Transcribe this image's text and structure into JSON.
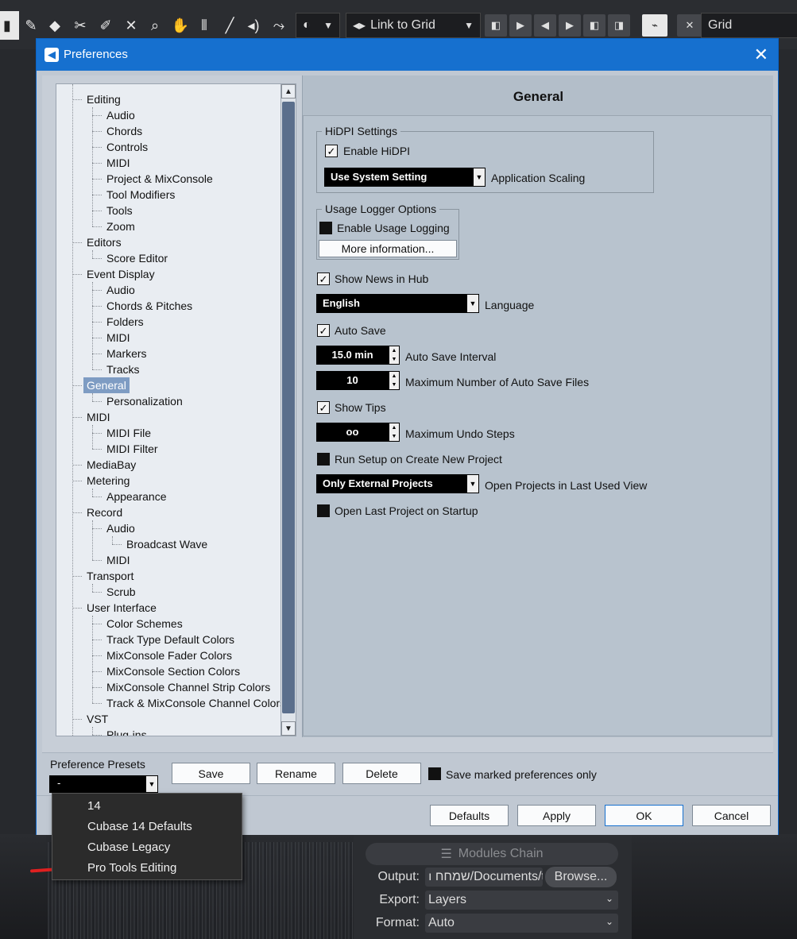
{
  "daw": {
    "toolbar": {
      "snap_mode": "Link to Grid",
      "grid_label": "Grid"
    },
    "bottom": {
      "modules_chain": "Modules Chain",
      "output_label": "Output:",
      "output_value": "ı שמחח/Documents/t",
      "browse_label": "Browse...",
      "export_label": "Export:",
      "export_value": "Layers",
      "format_label": "Format:",
      "format_value": "Auto"
    }
  },
  "dialog": {
    "title": "Preferences",
    "tree": [
      {
        "label": "Editing",
        "level": 0
      },
      {
        "label": "Audio",
        "level": 1
      },
      {
        "label": "Chords",
        "level": 1
      },
      {
        "label": "Controls",
        "level": 1
      },
      {
        "label": "MIDI",
        "level": 1
      },
      {
        "label": "Project & MixConsole",
        "level": 1
      },
      {
        "label": "Tool Modifiers",
        "level": 1
      },
      {
        "label": "Tools",
        "level": 1
      },
      {
        "label": "Zoom",
        "level": 1
      },
      {
        "label": "Editors",
        "level": 0
      },
      {
        "label": "Score Editor",
        "level": 1
      },
      {
        "label": "Event Display",
        "level": 0
      },
      {
        "label": "Audio",
        "level": 1
      },
      {
        "label": "Chords & Pitches",
        "level": 1
      },
      {
        "label": "Folders",
        "level": 1
      },
      {
        "label": "MIDI",
        "level": 1
      },
      {
        "label": "Markers",
        "level": 1
      },
      {
        "label": "Tracks",
        "level": 1
      },
      {
        "label": "General",
        "level": 0,
        "selected": true
      },
      {
        "label": "Personalization",
        "level": 1
      },
      {
        "label": "MIDI",
        "level": 0
      },
      {
        "label": "MIDI File",
        "level": 1
      },
      {
        "label": "MIDI Filter",
        "level": 1
      },
      {
        "label": "MediaBay",
        "level": 0
      },
      {
        "label": "Metering",
        "level": 0
      },
      {
        "label": "Appearance",
        "level": 1
      },
      {
        "label": "Record",
        "level": 0
      },
      {
        "label": "Audio",
        "level": 1
      },
      {
        "label": "Broadcast Wave",
        "level": 2
      },
      {
        "label": "MIDI",
        "level": 1
      },
      {
        "label": "Transport",
        "level": 0
      },
      {
        "label": "Scrub",
        "level": 1
      },
      {
        "label": "User Interface",
        "level": 0
      },
      {
        "label": "Color Schemes",
        "level": 1
      },
      {
        "label": "Track Type Default Colors",
        "level": 1
      },
      {
        "label": "MixConsole Fader Colors",
        "level": 1
      },
      {
        "label": "MixConsole Section Colors",
        "level": 1
      },
      {
        "label": "MixConsole Channel Strip Colors",
        "level": 1
      },
      {
        "label": "Track & MixConsole Channel Colors",
        "level": 1
      },
      {
        "label": "VST",
        "level": 0
      },
      {
        "label": "Plug-ins",
        "level": 1
      }
    ],
    "panel": {
      "heading": "General",
      "hidpi_group": "HiDPI Settings",
      "enable_hidpi": "Enable HiDPI",
      "scaling_value": "Use System Setting",
      "scaling_label": "Application Scaling",
      "usage_group": "Usage Logger Options",
      "enable_usage_logging": "Enable Usage Logging",
      "more_info": "More information...",
      "show_news": "Show News in Hub",
      "language_value": "English",
      "language_label": "Language",
      "auto_save": "Auto Save",
      "auto_save_interval_value": "15.0 min",
      "auto_save_interval_label": "Auto Save Interval",
      "max_auto_save_value": "10",
      "max_auto_save_label": "Maximum Number of Auto Save Files",
      "show_tips": "Show Tips",
      "max_undo_value": "oo",
      "max_undo_label": "Maximum Undo Steps",
      "run_setup": "Run Setup on Create New Project",
      "open_projects_value": "Only External Projects",
      "open_projects_label": "Open Projects in Last Used View",
      "open_last_project": "Open Last Project on Startup"
    },
    "presets": {
      "label": "Preference Presets",
      "selected": "-",
      "save": "Save",
      "rename": "Rename",
      "delete": "Delete",
      "save_marked_only": "Save marked preferences only",
      "options": [
        "14",
        "Cubase 14 Defaults",
        "Cubase Legacy",
        "Pro Tools Editing"
      ]
    },
    "footer": {
      "defaults": "Defaults",
      "apply": "Apply",
      "ok": "OK",
      "cancel": "Cancel"
    }
  }
}
